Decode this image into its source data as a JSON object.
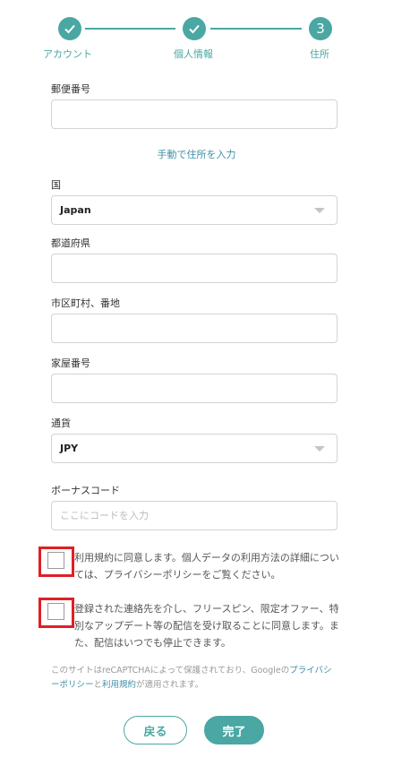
{
  "stepper": {
    "steps": [
      {
        "label": "アカウント",
        "state": "done"
      },
      {
        "label": "個人情報",
        "state": "done"
      },
      {
        "label": "住所",
        "state": "current",
        "number": "3"
      }
    ],
    "accent_color": "#4aa7a3"
  },
  "form": {
    "postal_code": {
      "label": "郵便番号",
      "value": ""
    },
    "manual_link": "手動で住所を入力",
    "country": {
      "label": "国",
      "value": "Japan"
    },
    "prefecture": {
      "label": "都道府県",
      "value": ""
    },
    "city": {
      "label": "市区町村、番地",
      "value": ""
    },
    "room": {
      "label": "家屋番号",
      "value": ""
    },
    "currency": {
      "label": "通貨",
      "value": "JPY"
    },
    "bonus_code": {
      "label": "ボーナスコード",
      "placeholder": "ここにコードを入力",
      "value": ""
    }
  },
  "consents": {
    "terms": {
      "text": "利用規約に同意します。個人データの利用方法の詳細については、プライバシーポリシーをご覧ください。",
      "checked": false
    },
    "marketing": {
      "text": "登録された連絡先を介し、フリースピン、限定オファー、特別なアップデート等の配信を受け取ることに同意します。また、配信はいつでも停止できます。",
      "checked": false
    }
  },
  "captcha": {
    "prefix": "このサイトはreCAPTCHAによって保護されており、Googleの",
    "privacy": "プライバシーポリシー",
    "and": "と",
    "terms": "利用規約",
    "suffix": "が適用されます。"
  },
  "buttons": {
    "back": "戻る",
    "done": "完了"
  }
}
